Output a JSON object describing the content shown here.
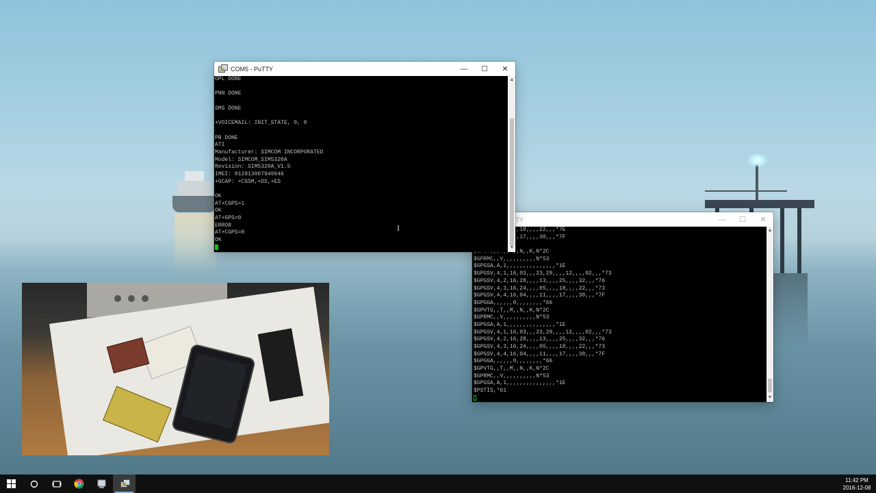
{
  "window1": {
    "title": "COM5 - PuTTY",
    "lines": [
      "OPL DONE",
      "",
      "PNN DONE",
      "",
      "SMS DONE",
      "",
      "+VOICEMAIL: INIT_STATE, 0, 0",
      "",
      "PB DONE",
      "ATI",
      "Manufacturer: SIMCOM INCORPORATED",
      "Model: SIMCOM_SIM5320A",
      "Revision: SIM5320A_V1.5",
      "IMEI: 012813007949946",
      "+GCAP: +CGSM,+DS,+ES",
      "",
      "OK",
      "AT+CGPS=1",
      "OK",
      "AT+GPS=0",
      "ERROR",
      "AT+CGPS=0",
      "OK"
    ]
  },
  "window2": {
    "title": "TTY",
    "lines": [
      "6,29,,,,05,,,,18,,,,22,,,*7E",
      "6,04,,,,11,,,,17,,,,30,,,*7F",
      "0,,,,,,,*66",
      "$GPVTG,,T,,M,,N,,K,N*2C",
      "$GPRMC,,V,,,,,,,,,,N*53",
      "$GPGSA,A,1,,,,,,,,,,,,,,,*1E",
      "$GPGSV,4,1,16,03,,,23,29,,,,12,,,,02,,,*73",
      "$GPGSV,4,2,16,28,,,,13,,,,25,,,,32,,,*76",
      "$GPGSV,4,3,16,24,,,,05,,,,18,,,,22,,,*73",
      "$GPGSV,4,4,16,04,,,,11,,,,17,,,,30,,,*7F",
      "$GPGGA,,,,,,0,,,,,,,,*66",
      "$GPVTG,,T,,M,,N,,K,N*2C",
      "$GPRMC,,V,,,,,,,,,,N*53",
      "$GPGSA,A,1,,,,,,,,,,,,,,,*1E",
      "$GPGSV,4,1,16,03,,,23,29,,,,12,,,,02,,,*73",
      "$GPGSV,4,2,16,28,,,,13,,,,25,,,,32,,,*76",
      "$GPGSV,4,3,16,24,,,,05,,,,18,,,,22,,,*73",
      "$GPGSV,4,4,16,04,,,,11,,,,17,,,,30,,,*7F",
      "$GPGGA,,,,,,0,,,,,,,,*66",
      "$GPVTG,,T,,M,,N,,K,N*2C",
      "$GPRMC,,V,,,,,,,,,,N*53",
      "$GPGSA,A,1,,,,,,,,,,,,,,,*1E",
      "$PSTIS,*61"
    ]
  },
  "controls": {
    "minimize": "—",
    "maximize": "☐",
    "close": "✕"
  },
  "taskbar": {
    "time": "11:42 PM",
    "date": "2016-12-08",
    "items": [
      {
        "name": "start-icon",
        "glyph": "⊞"
      },
      {
        "name": "search-icon",
        "glyph": "○"
      },
      {
        "name": "task-view-icon",
        "glyph": "⧉"
      },
      {
        "name": "chrome-icon",
        "glyph": "●"
      },
      {
        "name": "app-icon",
        "glyph": "▣"
      },
      {
        "name": "putty-taskbar-icon",
        "glyph": "▤"
      }
    ]
  },
  "colors": {
    "terminal_bg": "#000000",
    "terminal_text": "#c0c0c0",
    "cursor": "#00d000"
  }
}
